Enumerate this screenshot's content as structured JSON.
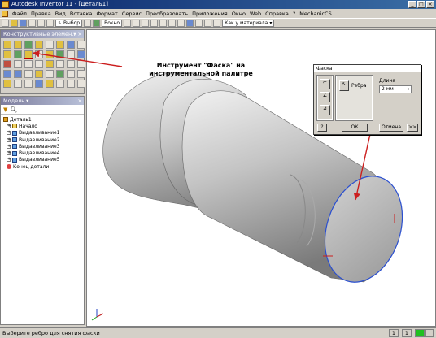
{
  "window": {
    "title": "Autodesk Inventor 11 - [Деталь1]"
  },
  "menu": [
    "Файл",
    "Правка",
    "Вид",
    "Вставка",
    "Формат",
    "Сервис",
    "Преобразовать",
    "Приложения",
    "Окно",
    "Web",
    "Справка",
    "MechanicCS"
  ],
  "toolbar": {
    "select_label": "Выбор",
    "view_label": "Вокно",
    "material_label": "Как у материала"
  },
  "palette": {
    "title": "Конструктивные элемен..."
  },
  "browser": {
    "title": "Модель",
    "items": [
      "Деталь1",
      "Начало",
      "Выдавливание1",
      "Выдавливание2",
      "Выдавливание3",
      "Выдавливание4",
      "Выдавливание5",
      "Конец детали"
    ]
  },
  "annotation": {
    "text": "Инструмент \"Фаска\" на инструментальной палитре"
  },
  "dialog": {
    "title": "Фаска",
    "edges_label": "Ребра",
    "length_label": "Длина",
    "length_value": "2 мм",
    "ok_label": "ОК",
    "cancel_label": "Отмена",
    "more_label": ">>"
  },
  "status": {
    "text": "Выберите ребро для снятия фаски",
    "cell1": "1",
    "cell2": "1"
  },
  "colors": {
    "arrow": "#cc1e1e",
    "title_active": "#0a246a",
    "edge_highlight": "#2a4fd0"
  }
}
